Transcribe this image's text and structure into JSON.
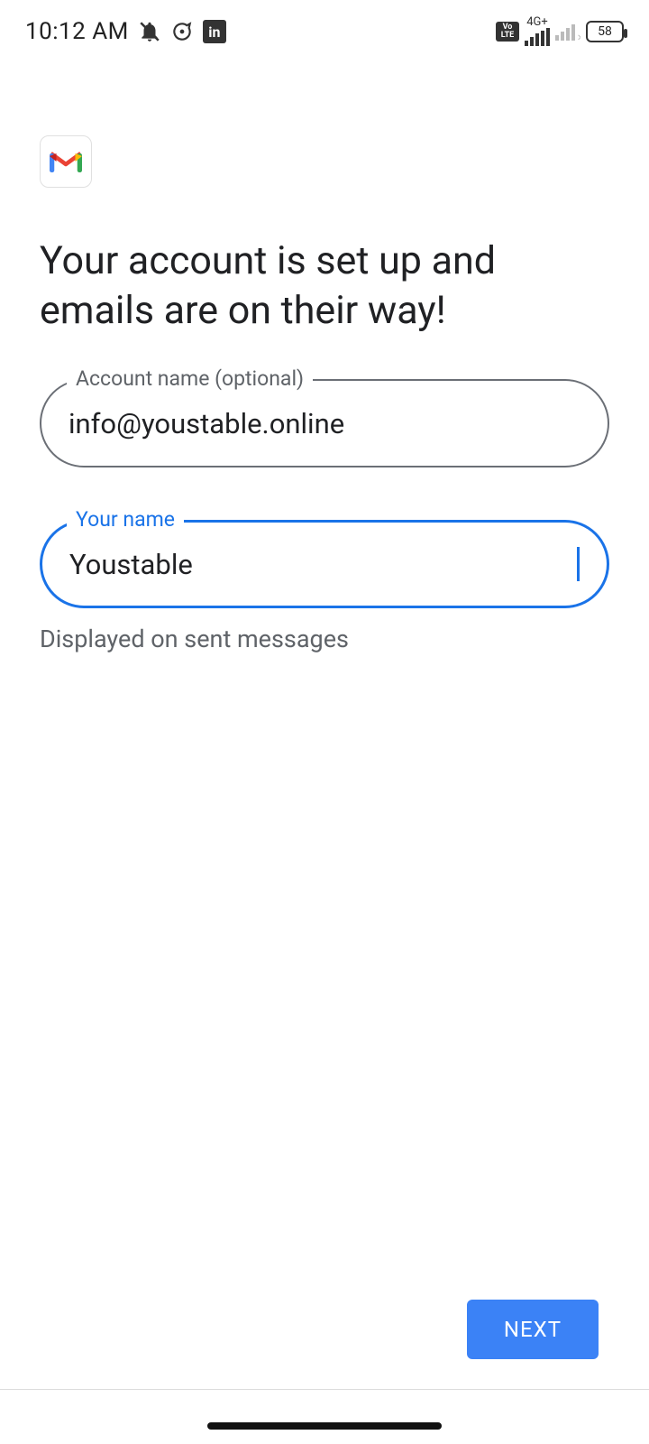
{
  "status": {
    "time": "10:12 AM",
    "network_label": "4G+",
    "battery": "58",
    "volte_top": "Vo",
    "volte_bottom": "LTE",
    "linkedin": "in"
  },
  "main": {
    "headline": "Your account is set up and emails are on their way!",
    "account_name": {
      "label": "Account name (optional)",
      "value": "info@youstable.online"
    },
    "your_name": {
      "label": "Your name",
      "value": "Youstable",
      "helper": "Displayed on sent messages"
    },
    "next": "NEXT"
  }
}
